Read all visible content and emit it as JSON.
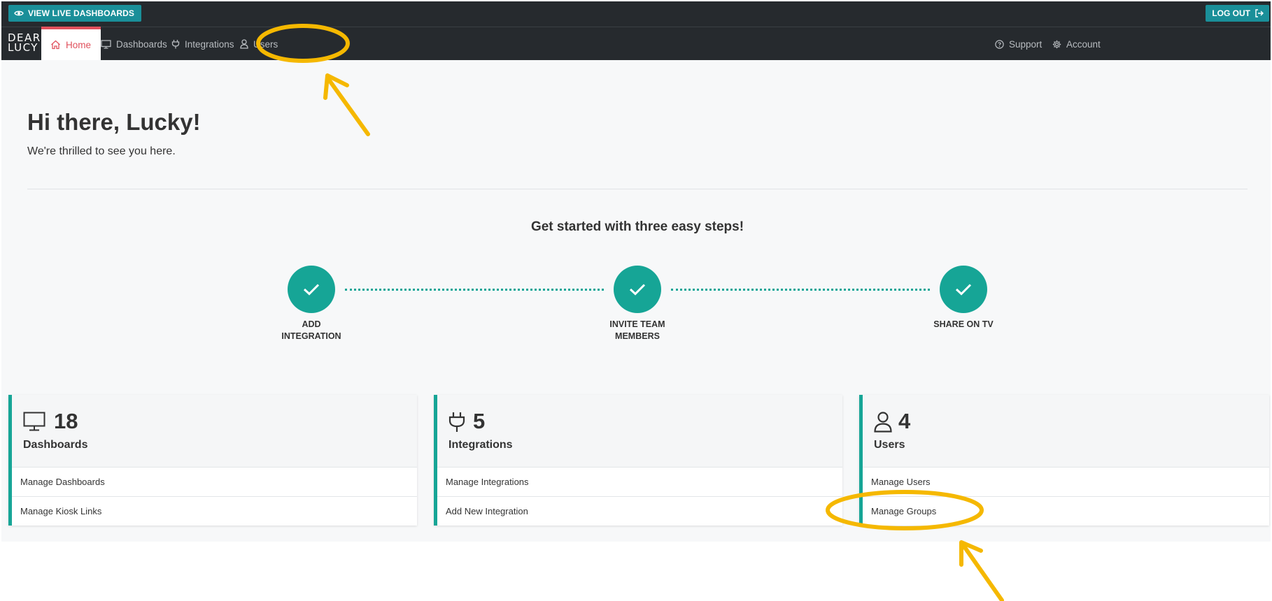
{
  "topbar": {
    "live_label": "VIEW LIVE DASHBOARDS",
    "logout_label": "LOG OUT"
  },
  "brand": {
    "line1": "DEAR",
    "line2": "LUCY"
  },
  "nav": {
    "home": "Home",
    "dashboards": "Dashboards",
    "integrations": "Integrations",
    "users": "Users",
    "support": "Support",
    "account": "Account"
  },
  "greeting": {
    "title": "Hi there, Lucky!",
    "subtitle": "We're thrilled to see you here."
  },
  "steps": {
    "title": "Get started with three easy steps!",
    "items": [
      {
        "line1": "ADD",
        "line2": "INTEGRATION"
      },
      {
        "line1": "INVITE TEAM",
        "line2": "MEMBERS"
      },
      {
        "line1": "SHARE ON TV",
        "line2": ""
      }
    ]
  },
  "cards": [
    {
      "count": "18",
      "title": "Dashboards",
      "icon": "monitor-icon",
      "links": [
        "Manage Dashboards",
        "Manage Kiosk Links"
      ]
    },
    {
      "count": "5",
      "title": "Integrations",
      "icon": "plug-icon",
      "links": [
        "Manage Integrations",
        "Add New Integration"
      ]
    },
    {
      "count": "4",
      "title": "Users",
      "icon": "user-icon",
      "links": [
        "Manage Users",
        "Manage Groups"
      ]
    }
  ],
  "colors": {
    "nav_bg": "#262a2e",
    "accent_teal": "#16a596",
    "button_teal": "#1a8f99",
    "active_red": "#e0505c",
    "annotation_yellow": "#f5b800"
  }
}
